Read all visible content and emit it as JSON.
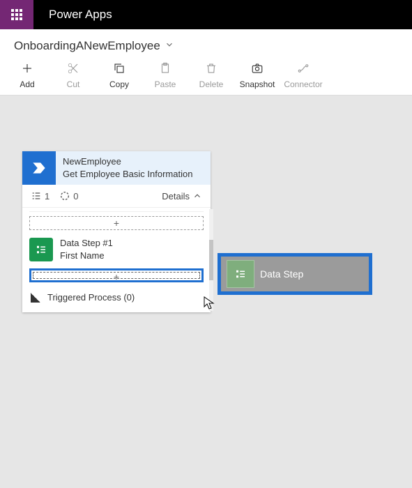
{
  "header": {
    "app_title": "Power Apps"
  },
  "subheader": {
    "flow_name": "OnboardingANewEmployee"
  },
  "toolbar": {
    "add": "Add",
    "cut": "Cut",
    "copy": "Copy",
    "paste": "Paste",
    "delete": "Delete",
    "snapshot": "Snapshot",
    "connector": "Connector"
  },
  "card": {
    "title": "NewEmployee",
    "subtitle": "Get Employee Basic Information",
    "meta": {
      "count1": "1",
      "count2": "0",
      "details": "Details"
    },
    "plus_top": "+",
    "step": {
      "title": "Data Step #1",
      "sub": "First Name"
    },
    "plus_bottom": "+",
    "triggered": "Triggered Process (0)"
  },
  "drag": {
    "label": "Data Step"
  }
}
